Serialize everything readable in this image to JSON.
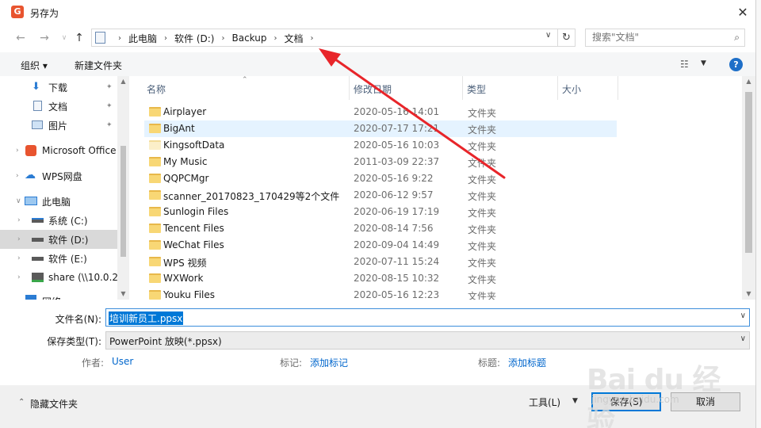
{
  "window": {
    "title": "另存为",
    "app_icon_letter": "G",
    "close_glyph": "✕"
  },
  "nav": {
    "back": "←",
    "forward": "→",
    "up": "↑",
    "refresh": "↻"
  },
  "address": {
    "crumbs": [
      "此电脑",
      "软件 (D:)",
      "Backup",
      "文档"
    ],
    "sep": "›",
    "dropdown": "∨"
  },
  "search": {
    "placeholder": "搜索\"文档\""
  },
  "toolbar": {
    "organize": "组织 ▾",
    "new_folder": "新建文件夹",
    "help": "?"
  },
  "sidebar": {
    "items": [
      {
        "label": "下载",
        "icon": "download-icon",
        "pinned": true
      },
      {
        "label": "文档",
        "icon": "document-icon",
        "pinned": true
      },
      {
        "label": "图片",
        "icon": "picture-icon",
        "pinned": true
      },
      {
        "label": "Microsoft Office",
        "icon": "office-icon"
      },
      {
        "label": "WPS网盘",
        "icon": "cloud-icon"
      },
      {
        "label": "此电脑",
        "icon": "computer-icon"
      },
      {
        "label": "系统 (C:)",
        "icon": "drive-icon"
      },
      {
        "label": "软件 (D:)",
        "icon": "drive-icon",
        "selected": true
      },
      {
        "label": "软件 (E:)",
        "icon": "drive-icon"
      },
      {
        "label": "share (\\\\10.0.2.",
        "icon": "network-drive-icon"
      },
      {
        "label": "网络",
        "icon": "network-icon"
      }
    ]
  },
  "columns": {
    "name": "名称",
    "date": "修改日期",
    "type": "类型",
    "size": "大小"
  },
  "files": [
    {
      "name": "Airplayer",
      "date": "2020-05-16 14:01",
      "type": "文件夹"
    },
    {
      "name": "BigAnt",
      "date": "2020-07-17 17:21",
      "type": "文件夹"
    },
    {
      "name": "KingsoftData",
      "date": "2020-05-16 10:03",
      "type": "文件夹"
    },
    {
      "name": "My Music",
      "date": "2011-03-09 22:37",
      "type": "文件夹"
    },
    {
      "name": "QQPCMgr",
      "date": "2020-05-16 9:22",
      "type": "文件夹"
    },
    {
      "name": "scanner_20170823_170429等2个文件",
      "date": "2020-06-12 9:57",
      "type": "文件夹"
    },
    {
      "name": "Sunlogin Files",
      "date": "2020-06-19 17:19",
      "type": "文件夹"
    },
    {
      "name": "Tencent Files",
      "date": "2020-08-14 7:56",
      "type": "文件夹"
    },
    {
      "name": "WeChat Files",
      "date": "2020-09-04 14:49",
      "type": "文件夹"
    },
    {
      "name": "WPS 视频",
      "date": "2020-07-11 15:24",
      "type": "文件夹"
    },
    {
      "name": "WXWork",
      "date": "2020-08-15 10:32",
      "type": "文件夹"
    },
    {
      "name": "Youku Files",
      "date": "2020-05-16 12:23",
      "type": "文件夹"
    }
  ],
  "form": {
    "filename_label": "文件名(N):",
    "filename_value": "培训新员工.ppsx",
    "filetype_label": "保存类型(T):",
    "filetype_value": "PowerPoint 放映(*.ppsx)",
    "author_label": "作者:",
    "author_value": "User",
    "tags_label": "标记:",
    "tags_value": "添加标记",
    "title_label": "标题:",
    "title_value": "添加标题"
  },
  "footer": {
    "hide_folders": "隐藏文件夹",
    "tools": "工具(L)",
    "save": "保存(S)",
    "cancel": "取消"
  },
  "watermark": {
    "main": "Bai du 经验",
    "sub": "jingyan.baidu.com"
  },
  "colors": {
    "accent": "#0078d7",
    "arrow": "#e8252a",
    "folder": "#f8d775"
  }
}
